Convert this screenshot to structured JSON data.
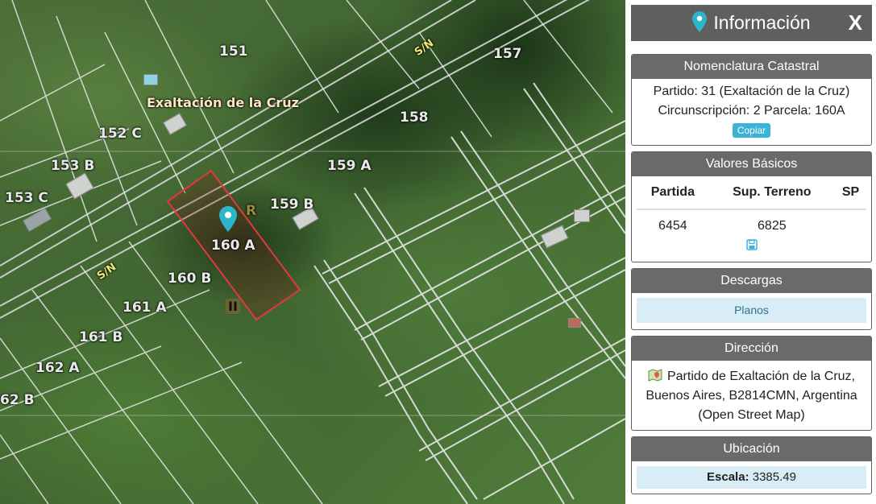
{
  "map": {
    "labels": {
      "p151": "151",
      "p157": "157",
      "p158": "158",
      "p152c": "152 C",
      "p153b": "153 B",
      "p153c": "153 C",
      "p159a": "159 A",
      "p159b": "159 B",
      "p160a": "160 A",
      "p160b": "160 B",
      "p161a": "161 A",
      "p161b": "161 B",
      "p162a": "162 A",
      "p162b": "62 B",
      "sn1": "S/N",
      "sn2": "S/N",
      "city": "Exaltación de la Cruz",
      "r": "R",
      "ii": "II"
    },
    "colors": {
      "parcel_lines": "#e8e8e8",
      "selected_outline": "#e03a3a",
      "marker": "#2bb6c9"
    },
    "marker_icon": "map-pin-icon"
  },
  "panel": {
    "header": {
      "title": "Información",
      "close": "X",
      "icon": "map-pin-icon"
    },
    "nomenclatura": {
      "title": "Nomenclatura Catastral",
      "line1": "Partido: 31 (Exaltación de la Cruz)",
      "line2": "Circunscripción: 2 Parcela: 160A",
      "copy": "Copiar"
    },
    "valores": {
      "title": "Valores Básicos",
      "headers": [
        "Partida",
        "Sup. Terreno",
        "SP"
      ],
      "row": [
        "6454",
        "6825",
        ""
      ],
      "save_icon": "save-icon"
    },
    "descargas": {
      "title": "Descargas",
      "planos": "Planos"
    },
    "direccion": {
      "title": "Dirección",
      "icon": "map-icon",
      "text": "Partido de Exaltación de la Cruz, Buenos Aires, B2814CMN, Argentina (Open Street Map)"
    },
    "ubicacion": {
      "title": "Ubicación",
      "scale_label": "Escala:",
      "scale_value": "3385.49"
    }
  }
}
